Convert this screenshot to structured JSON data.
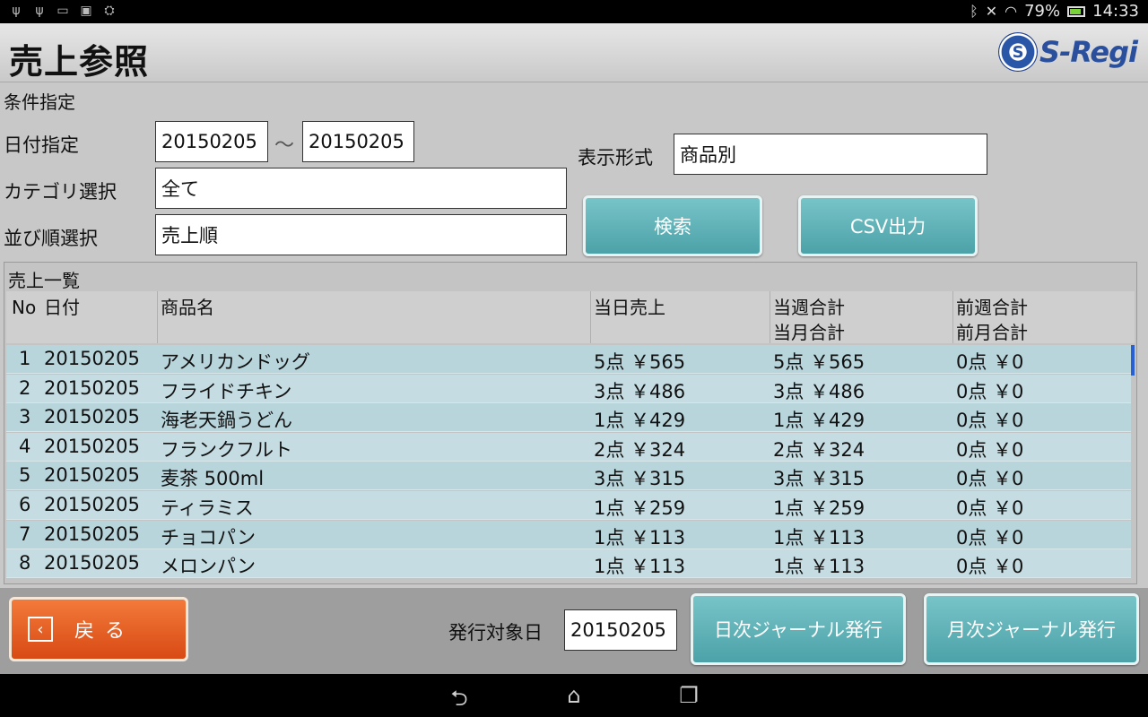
{
  "status_bar": {
    "left_icons": [
      "usb-icon",
      "usb-debug-icon",
      "screenshot-icon",
      "image-icon",
      "android-icon"
    ],
    "battery": "79%",
    "time": "14:33"
  },
  "header": {
    "title": "売上参照",
    "logo_text": "S-Regi",
    "logo_mark": "S"
  },
  "conditions": {
    "section_label": "条件指定",
    "date_label": "日付指定",
    "date_from": "20150205",
    "tilde": "～",
    "date_to": "20150205",
    "category_label": "カテゴリ選択",
    "category_value": "全て",
    "sort_label": "並び順選択",
    "sort_value": "売上順",
    "display_label": "表示形式",
    "display_value": "商品別",
    "search_button": "検索",
    "csv_button": "CSV出力"
  },
  "sales_list": {
    "title": "売上一覧",
    "headers": {
      "no": "No",
      "date": "日付",
      "product": "商品名",
      "day_sales": "当日売上",
      "week_total": "当週合計",
      "month_total": "当月合計",
      "prev_week_total": "前週合計",
      "prev_month_total": "前月合計"
    },
    "rows": [
      {
        "no": "1",
        "date": "20150205",
        "product": "アメリカンドッグ",
        "day": "5点 ￥565",
        "week": "5点 ￥565",
        "prev": "0点 ￥0"
      },
      {
        "no": "2",
        "date": "20150205",
        "product": "フライドチキン",
        "day": "3点 ￥486",
        "week": "3点 ￥486",
        "prev": "0点 ￥0"
      },
      {
        "no": "3",
        "date": "20150205",
        "product": "海老天鍋うどん",
        "day": "1点 ￥429",
        "week": "1点 ￥429",
        "prev": "0点 ￥0"
      },
      {
        "no": "4",
        "date": "20150205",
        "product": "フランクフルト",
        "day": "2点 ￥324",
        "week": "2点 ￥324",
        "prev": "0点 ￥0"
      },
      {
        "no": "5",
        "date": "20150205",
        "product": "麦茶 500ml",
        "day": "3点 ￥315",
        "week": "3点 ￥315",
        "prev": "0点 ￥0"
      },
      {
        "no": "6",
        "date": "20150205",
        "product": "ティラミス",
        "day": "1点 ￥259",
        "week": "1点 ￥259",
        "prev": "0点 ￥0"
      },
      {
        "no": "7",
        "date": "20150205",
        "product": "チョコパン",
        "day": "1点 ￥113",
        "week": "1点 ￥113",
        "prev": "0点 ￥0"
      },
      {
        "no": "8",
        "date": "20150205",
        "product": "メロンパン",
        "day": "1点 ￥113",
        "week": "1点 ￥113",
        "prev": "0点 ￥0"
      }
    ]
  },
  "footer": {
    "back_button": "戻る",
    "issue_date_label": "発行対象日",
    "issue_date_value": "20150205",
    "daily_journal_button": "日次ジャーナル発行",
    "monthly_journal_button": "月次ジャーナル発行"
  },
  "navbar": {
    "icons": [
      "back-nav-icon",
      "home-nav-icon",
      "recent-apps-icon"
    ]
  }
}
